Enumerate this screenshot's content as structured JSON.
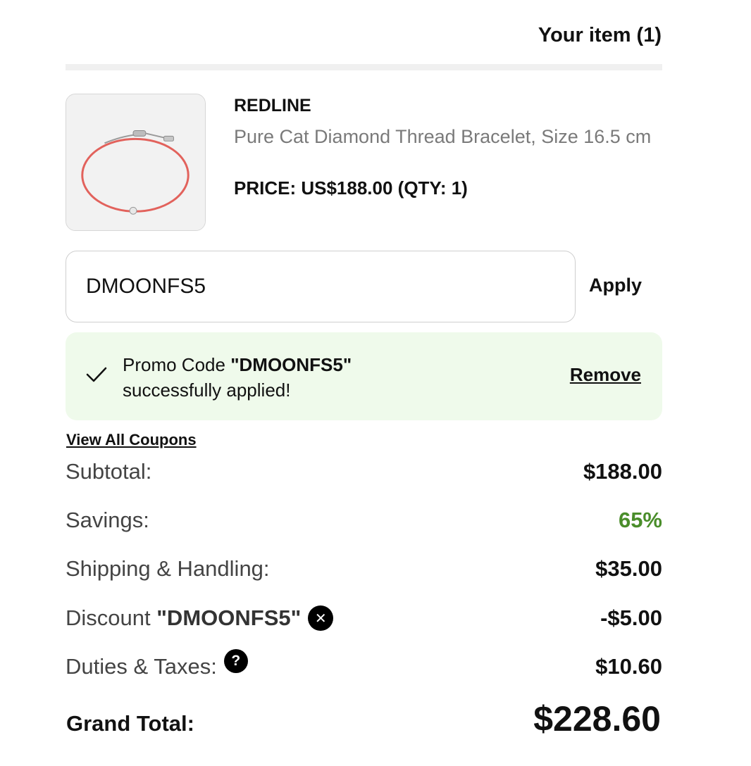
{
  "cart": {
    "title": "Your item (1)"
  },
  "item": {
    "brand": "REDLINE",
    "name": "Pure Cat Diamond Thread Bracelet, Size 16.5 cm",
    "price_line": "PRICE: US$188.00 (QTY: 1)",
    "image_icon": "bracelet-image"
  },
  "promo": {
    "input_value": "DMOONFS5",
    "apply_label": "Apply",
    "success_prefix": "Promo Code ",
    "success_code": "\"DMOONFS5\"",
    "success_suffix": "successfully applied!",
    "remove_label": "Remove",
    "banner_color": "#effaeb"
  },
  "coupons": {
    "view_all_label": "View All Coupons"
  },
  "summary": {
    "subtotal_label": "Subtotal:",
    "subtotal_value": "$188.00",
    "savings_label": "Savings:",
    "savings_value": "65%",
    "savings_color": "#4a8d2a",
    "shipping_label": "Shipping & Handling:",
    "shipping_value": "$35.00",
    "discount_label": "Discount ",
    "discount_code": "\"DMOONFS5\"",
    "discount_value": "-$5.00",
    "discount_remove_icon": "close-icon",
    "duties_label": "Duties & Taxes:",
    "duties_help_icon": "question-icon",
    "duties_value": "$10.60",
    "grand_label": "Grand Total:",
    "grand_value": "$228.60"
  }
}
